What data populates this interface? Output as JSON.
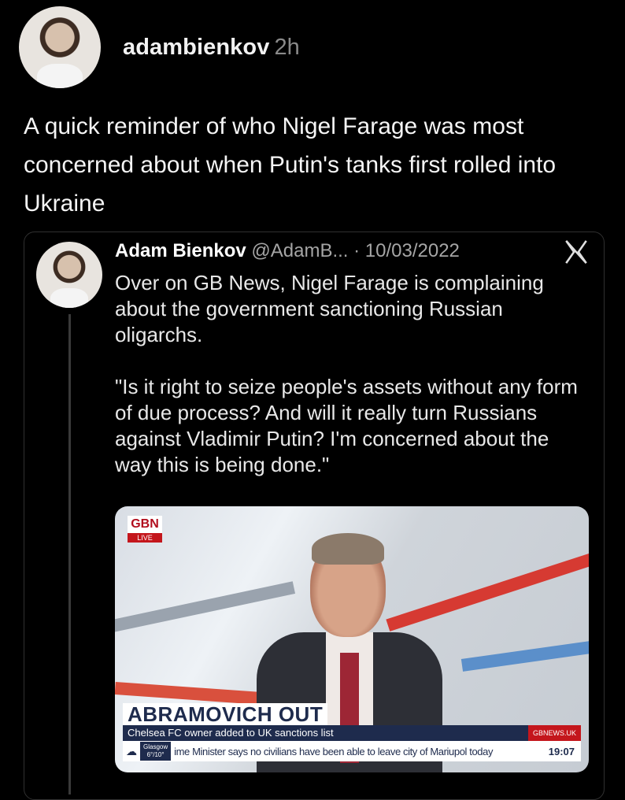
{
  "post": {
    "username": "adambienkov",
    "time": "2h",
    "text": "A quick reminder of who Nigel Farage was most concerned about when Putin's tanks first rolled into Ukraine"
  },
  "quoted_tweet": {
    "name": "Adam Bienkov",
    "meta": "@AdamB... · 10/03/2022",
    "paragraph1": "Over on GB News, Nigel Farage is complaining about the government sanctioning Russian oligarchs.",
    "paragraph2": "\"Is it right to seize people's assets without any form of due process? And will it really turn Russians against Vladimir Putin? I'm concerned about the way this is being done.\"",
    "source_icon": "x-logo-icon"
  },
  "media": {
    "channel_logo": "GBN",
    "live_label": "LIVE",
    "headline": "ABRAMOVICH OUT",
    "strap": "Chelsea FC owner added to UK sanctions list",
    "url": "GBNEWS.UK",
    "weather_city": "Glasgow",
    "weather_temp": "6°/10°",
    "ticker": "ime Minister says no civilians have been able to leave city of Mariupol today",
    "clock": "19:07"
  },
  "colors": {
    "background": "#000000",
    "gbn_red": "#c4161c",
    "gbn_navy": "#1e2b4d"
  }
}
